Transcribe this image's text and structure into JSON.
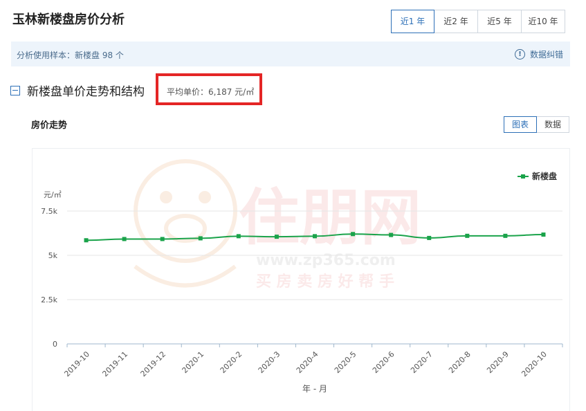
{
  "header": {
    "title": "玉林新楼盘房价分析"
  },
  "range_tabs": [
    {
      "label": "近1 年",
      "active": true
    },
    {
      "label": "近2 年",
      "active": false
    },
    {
      "label": "近5 年",
      "active": false
    },
    {
      "label": "近10 年",
      "active": false
    }
  ],
  "sample": {
    "text": "分析使用样本：新楼盘 98 个",
    "correction_label": "数据纠错"
  },
  "section": {
    "title": "新楼盘单价走势和结构",
    "avg_price": "平均单价：6,187 元/㎡"
  },
  "trend": {
    "title": "房价走势"
  },
  "view_tabs": [
    {
      "label": "图表",
      "active": true
    },
    {
      "label": "数据",
      "active": false
    }
  ],
  "watermark": {
    "brand": "住朋网",
    "url": "www.zp365.com",
    "slogan": "买 房 卖 房 好 帮 手"
  },
  "colors": {
    "accent": "#2c6fb7",
    "series": "#1aa34a",
    "highlight_box": "#e42525"
  },
  "chart_data": {
    "type": "line",
    "x": [
      "2019-10",
      "2019-11",
      "2019-12",
      "2020-1",
      "2020-2",
      "2020-3",
      "2020-4",
      "2020-5",
      "2020-6",
      "2020-7",
      "2020-8",
      "2020-9",
      "2020-10"
    ],
    "series": [
      {
        "name": "新楼盘",
        "values": [
          5850,
          5920,
          5920,
          5960,
          6080,
          6050,
          6080,
          6200,
          6150,
          5980,
          6100,
          6100,
          6170
        ]
      }
    ],
    "xlabel": "年 - 月",
    "ylabel": "元/㎡",
    "yticks": [
      "0",
      "2.5k",
      "5k",
      "7.5k"
    ],
    "ylim": [
      0,
      7500
    ],
    "grid": true,
    "legend": "top-right"
  }
}
